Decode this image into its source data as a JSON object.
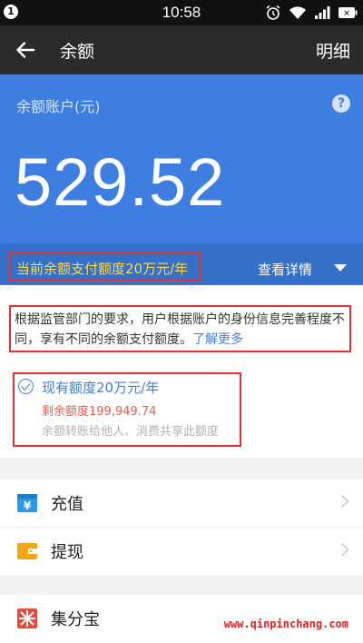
{
  "status_bar": {
    "badge": "1",
    "time": "10:58",
    "icons": [
      "alarm-icon",
      "wifi-icon",
      "signal-icon",
      "battery-icon"
    ]
  },
  "app_bar": {
    "back_icon": "back-arrow-icon",
    "title": "余额",
    "action_label": "明细"
  },
  "balance": {
    "label": "余额账户(元)",
    "help_icon": "help-icon",
    "help_glyph": "?",
    "amount": "529.52",
    "limit_text": "当前余额支付额度20万元/年",
    "view_detail_label": "查看详情"
  },
  "notice": {
    "text": "根据监管部门的要求，用户根据账户的身份信息完善程度不同，享有不同的余额支付额度。",
    "learn_more": "了解更多"
  },
  "quota": {
    "title": "现有额度20万元/年",
    "remaining": "剩余额度199,949.74",
    "note": "余额转账给他人、消费共享此额度"
  },
  "menu_group_1": [
    {
      "label": "充值",
      "icon": "recharge-icon"
    },
    {
      "label": "提现",
      "icon": "wallet-icon"
    }
  ],
  "menu_group_2": [
    {
      "label": "集分宝",
      "icon": "jifenbao-icon"
    }
  ],
  "watermark": "www.qinpinchang.com",
  "colors": {
    "app_bar": "#2b2b2b",
    "hero_blue": "#3d7ee0",
    "limit_yellow": "#ffd94a",
    "highlight_red": "#e53030",
    "remaining_red": "#e85a4f"
  }
}
